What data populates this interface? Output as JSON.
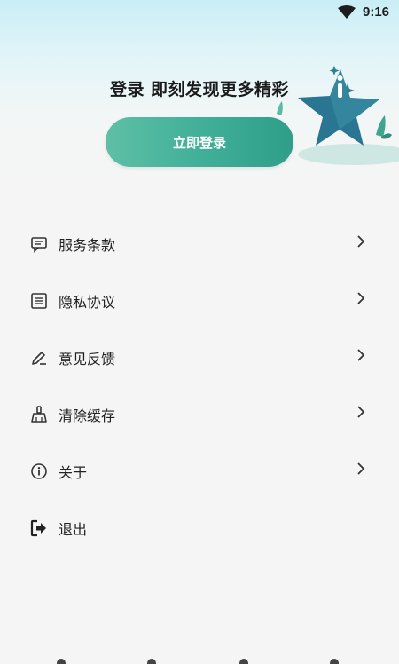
{
  "status_bar": {
    "time": "9:16",
    "wifi_icon": "wifi-icon"
  },
  "header": {
    "title": "登录 即刻发现更多精彩",
    "login_button": "立即登录",
    "mascot": "star-mascot-illustration"
  },
  "colors": {
    "accent": "#3fae97",
    "accent_dark": "#1f6e8a",
    "text": "#222222",
    "background": "#f5f5f5"
  },
  "menu": {
    "items": [
      {
        "label": "服务条款",
        "icon": "terms-icon"
      },
      {
        "label": "隐私协议",
        "icon": "privacy-icon"
      },
      {
        "label": "意见反馈",
        "icon": "feedback-pen-icon"
      },
      {
        "label": "清除缓存",
        "icon": "broom-icon"
      },
      {
        "label": "关于",
        "icon": "info-icon"
      },
      {
        "label": "退出",
        "icon": "logout-icon"
      }
    ]
  }
}
